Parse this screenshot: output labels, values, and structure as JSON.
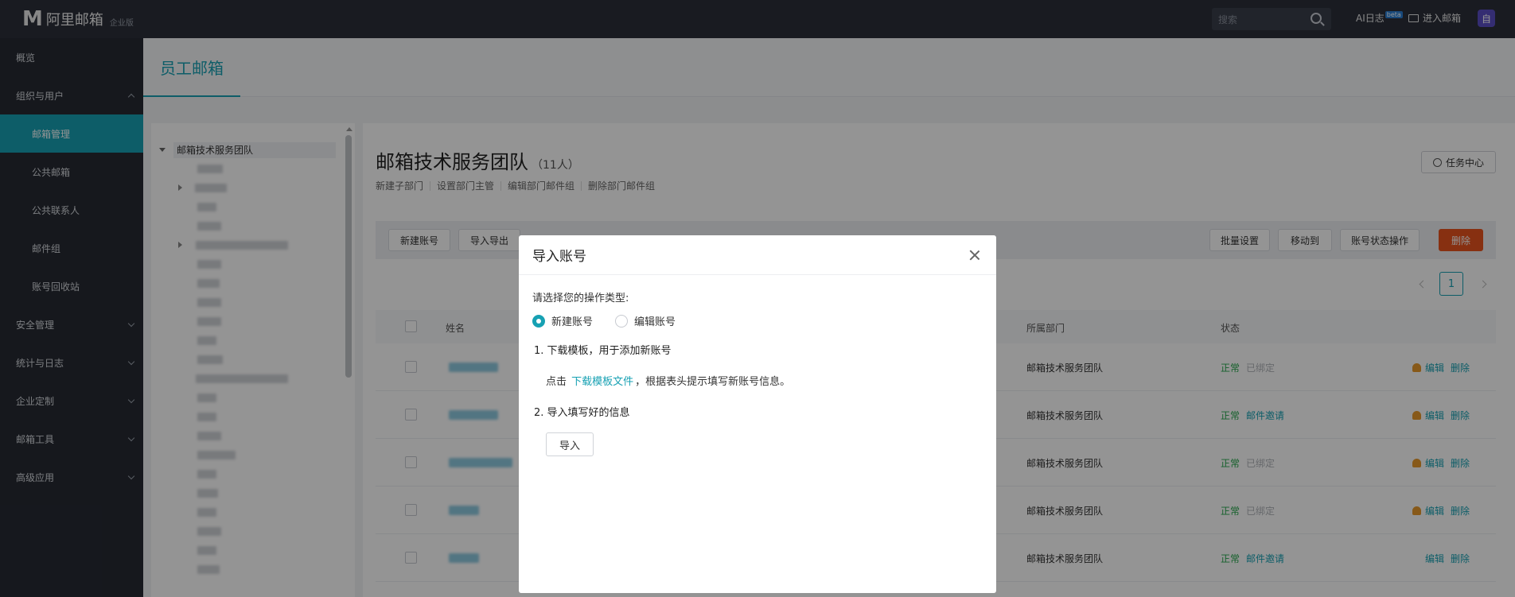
{
  "topbar": {
    "logo_mark": "M",
    "logo_text": "阿里邮箱",
    "logo_edition": "企业版",
    "search_placeholder": "搜索",
    "ai_log": "AI日志",
    "ai_badge": "beta",
    "enter_mail": "进入邮箱",
    "avatar_letter": "自"
  },
  "sidebar": {
    "items": [
      {
        "label": "概览"
      },
      {
        "label": "组织与用户"
      },
      {
        "label": "邮箱管理"
      },
      {
        "label": "公共邮箱"
      },
      {
        "label": "公共联系人"
      },
      {
        "label": "邮件组"
      },
      {
        "label": "账号回收站"
      },
      {
        "label": "安全管理"
      },
      {
        "label": "统计与日志"
      },
      {
        "label": "企业定制"
      },
      {
        "label": "邮箱工具"
      },
      {
        "label": "高级应用"
      }
    ]
  },
  "page": {
    "tab": "员工邮箱"
  },
  "tree": {
    "root": "邮箱技术服务团队"
  },
  "main": {
    "team_name": "邮箱技术服务团队",
    "team_count": "（11人）",
    "task_center": "任务中心",
    "dept_links": [
      "新建子部门",
      "设置部门主管",
      "编辑部门邮件组",
      "删除部门邮件组"
    ],
    "toolbar": {
      "new_account": "新建账号",
      "import_export": "导入导出",
      "batch_settings": "批量设置",
      "move_to": "移动到",
      "account_status": "账号状态操作",
      "delete": "删除"
    },
    "page_number": "1",
    "columns": {
      "name": "姓名",
      "dept": "所属部门",
      "status": "状态"
    },
    "rows": [
      {
        "dept": "邮箱技术服务团队",
        "status": "正常",
        "extra": "已绑定",
        "extra_type": "muted",
        "has_icon": true
      },
      {
        "dept": "邮箱技术服务团队",
        "status": "正常",
        "extra": "邮件邀请",
        "extra_type": "link",
        "has_icon": true
      },
      {
        "dept": "邮箱技术服务团队",
        "status": "正常",
        "extra": "已绑定",
        "extra_type": "muted",
        "has_icon": true
      },
      {
        "dept": "邮箱技术服务团队",
        "status": "正常",
        "extra": "已绑定",
        "extra_type": "muted",
        "has_icon": true
      },
      {
        "dept": "邮箱技术服务团队",
        "status": "正常",
        "extra": "邮件邀请",
        "extra_type": "link",
        "has_icon": false
      }
    ],
    "row_ops": {
      "edit": "编辑",
      "delete": "删除"
    }
  },
  "modal": {
    "title": "导入账号",
    "op_type_label": "请选择您的操作类型:",
    "option_new": "新建账号",
    "option_edit": "编辑账号",
    "selected": "新建账号",
    "step1": "1. 下载模板，用于添加新账号",
    "step1_prefix": "点击",
    "step1_link": "下载模板文件",
    "step1_suffix": "，根据表头提示填写新账号信息。",
    "step2": "2. 导入填写好的信息",
    "import_button": "导入"
  },
  "colors": {
    "accent": "#17a1b3",
    "topbar": "#2b2f3a",
    "sidebar": "#262a33",
    "danger": "#e8541e",
    "ok": "#26a84c"
  }
}
